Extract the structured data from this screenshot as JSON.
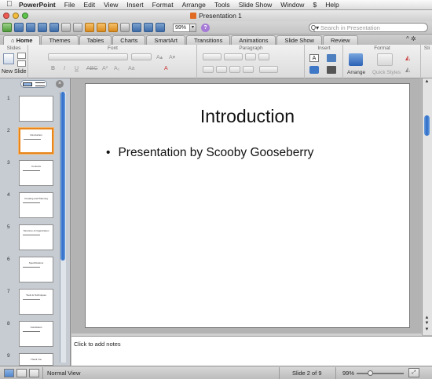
{
  "menubar": {
    "apple": "",
    "app_name": "PowerPoint",
    "items": [
      "File",
      "Edit",
      "View",
      "Insert",
      "Format",
      "Arrange",
      "Tools",
      "Slide Show",
      "Window",
      "Help"
    ],
    "script_icon": "$"
  },
  "window": {
    "title": "Presentation 1"
  },
  "toolbar": {
    "zoom_value": "99%",
    "zoom_arrow": "▾",
    "help_label": "?"
  },
  "search": {
    "placeholder": "Search in Presentation",
    "icon": "Q▾"
  },
  "ribbon": {
    "tabs": [
      "Home",
      "Themes",
      "Tables",
      "Charts",
      "SmartArt",
      "Transitions",
      "Animations",
      "Slide Show",
      "Review"
    ],
    "active_tab": "Home",
    "collapse_ctl": "^ ✲",
    "groups": [
      "Slides",
      "Font",
      "Paragraph",
      "Insert",
      "Format",
      "Sli"
    ],
    "new_slide_label": "New Slide",
    "arrange_label": "Arrange",
    "quick_styles_label": "Quick Styles",
    "bold": "B",
    "italic": "I",
    "underline": "U",
    "strike": "ABC",
    "superscript": "A²",
    "subscript": "A₂",
    "font_case": "Aa",
    "font_color": "A",
    "grow": "A▴",
    "shrink": "A▾"
  },
  "sidebar": {
    "close_icon": "×",
    "slides": [
      {
        "num": "1",
        "title": "",
        "selected": false
      },
      {
        "num": "2",
        "title": "Introduction",
        "selected": true
      },
      {
        "num": "3",
        "title": "Contents",
        "selected": false
      },
      {
        "num": "4",
        "title": "Creating and Planning",
        "selected": false
      },
      {
        "num": "5",
        "title": "Structure & Organization",
        "selected": false
      },
      {
        "num": "6",
        "title": "Specifications",
        "selected": false
      },
      {
        "num": "7",
        "title": "Tools & Techniques",
        "selected": false
      },
      {
        "num": "8",
        "title": "Conclusion",
        "selected": false
      },
      {
        "num": "9",
        "title": "Thank You",
        "selected": false
      }
    ]
  },
  "slide": {
    "title": "Introduction",
    "bullet": "•",
    "bullet_text": "Presentation by Scooby Gooseberry"
  },
  "notes": {
    "placeholder": "Click to add notes"
  },
  "status": {
    "view_name": "Normal View",
    "slide_position": "Slide 2 of 9",
    "zoom": "99%",
    "fit_icon": "⤢"
  },
  "colors": {
    "accent": "#2d6ac6",
    "selected_thumb": "#e8851b"
  }
}
